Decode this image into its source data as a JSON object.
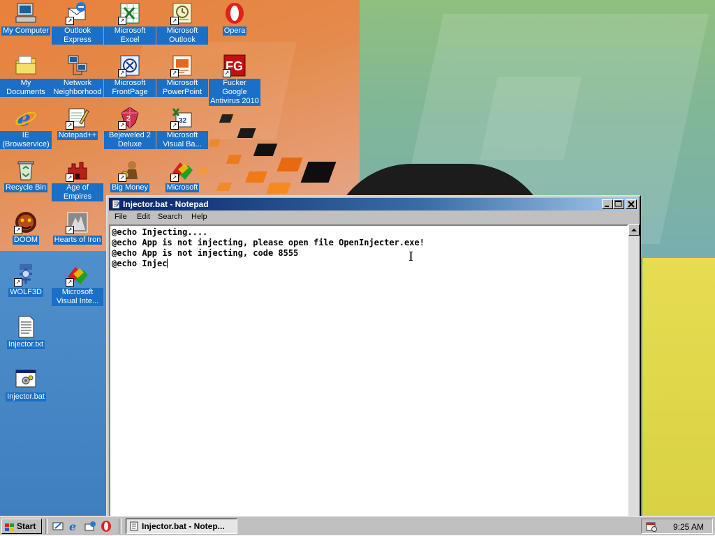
{
  "colors": {
    "title_bar": "#0a246a",
    "selection": "#1a6fc6",
    "face": "#c0c0c0"
  },
  "desktop_icons": [
    {
      "label": "My Computer",
      "icon": "computer-icon"
    },
    {
      "label": "Outlook Express",
      "icon": "outlook-express-icon"
    },
    {
      "label": "Microsoft Excel",
      "icon": "excel-icon"
    },
    {
      "label": "Microsoft Outlook",
      "icon": "outlook-icon"
    },
    {
      "label": "Opera",
      "icon": "opera-icon"
    },
    {
      "label": "My Documents",
      "icon": "folder-icon"
    },
    {
      "label": "Network Neighborhood",
      "icon": "network-icon"
    },
    {
      "label": "Microsoft FrontPage",
      "icon": "frontpage-icon"
    },
    {
      "label": "Microsoft PowerPoint",
      "icon": "powerpoint-icon"
    },
    {
      "label": "Fucker Google Antivirus 2010",
      "icon": "antivirus-icon"
    },
    {
      "label": "IE (Browservice)",
      "icon": "internet-explorer-icon"
    },
    {
      "label": "Notepad++",
      "icon": "notepad-plus-icon"
    },
    {
      "label": "Bejeweled 2 Deluxe",
      "icon": "bejeweled-icon"
    },
    {
      "label": "Microsoft Visual Ba...",
      "icon": "visual-basic-icon"
    },
    {
      "label": "Recycle Bin",
      "icon": "recycle-bin-icon"
    },
    {
      "label": "Age of Empires",
      "icon": "age-of-empires-icon"
    },
    {
      "label": "Big Money",
      "icon": "big-money-icon"
    },
    {
      "label": "Microsoft",
      "icon": "visual-studio-icon"
    },
    {
      "label": "DOOM",
      "icon": "doom-icon"
    },
    {
      "label": "Hearts of Iron",
      "icon": "hearts-of-iron-icon"
    },
    {
      "label": "WOLF3D",
      "icon": "wolf3d-icon"
    },
    {
      "label": "Microsoft Visual Inte...",
      "icon": "visual-interdev-icon"
    },
    {
      "label": "Injector.txt",
      "icon": "text-file-icon"
    },
    {
      "label": "Injector.bat",
      "icon": "batch-file-icon"
    }
  ],
  "notepad": {
    "title": "Injector.bat - Notepad",
    "menu": [
      {
        "label": "File"
      },
      {
        "label": "Edit"
      },
      {
        "label": "Search"
      },
      {
        "label": "Help"
      }
    ],
    "lines": [
      "@echo Injecting....",
      "@echo App is not injecting, please open file OpenInjecter.exe!",
      "@echo App is not injecting, code 8555",
      "@echo Injec"
    ]
  },
  "taskbar": {
    "start_label": "Start",
    "task_label": "Injector.bat - Notep...",
    "clock": "9:25 AM"
  }
}
